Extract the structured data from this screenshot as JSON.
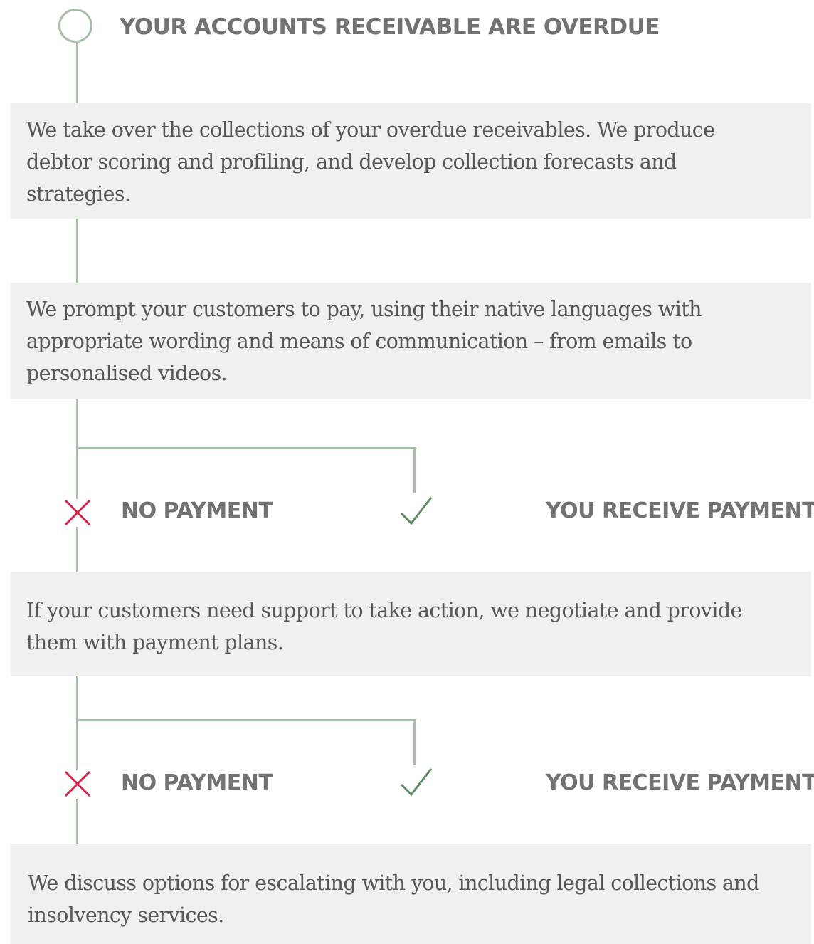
{
  "title": "YOUR ACCOUNTS RECEIVABLE ARE OVERDUE",
  "steps": [
    {
      "text": "We take over the collections of your overdue receivables. We produce debtor scoring and profiling, and develop collection forecasts and strategies."
    },
    {
      "text": "We prompt your customers to pay, using their native languages with appropriate wording and means of communication – from emails to personalised videos."
    },
    {
      "text": "If your customers need support to take action, we negotiate and provide them with payment plans."
    },
    {
      "text": "We discuss options for escalating with you, including legal collections and insolvency services."
    }
  ],
  "branches": [
    {
      "fail_label": "NO PAYMENT",
      "success_label": "YOU RECEIVE PAYMENT"
    },
    {
      "fail_label": "NO PAYMENT",
      "success_label": "YOU RECEIVE PAYMENT"
    }
  ],
  "colors": {
    "line": "#a9bea6",
    "fail_icon": "#d9254a",
    "success_icon": "#5e8a63",
    "heading_text": "#707471",
    "body_text": "#545955",
    "box_bg": "#f0f0f0"
  },
  "icons": {
    "start": "circle-icon",
    "fail": "cross-icon",
    "success": "check-icon"
  }
}
